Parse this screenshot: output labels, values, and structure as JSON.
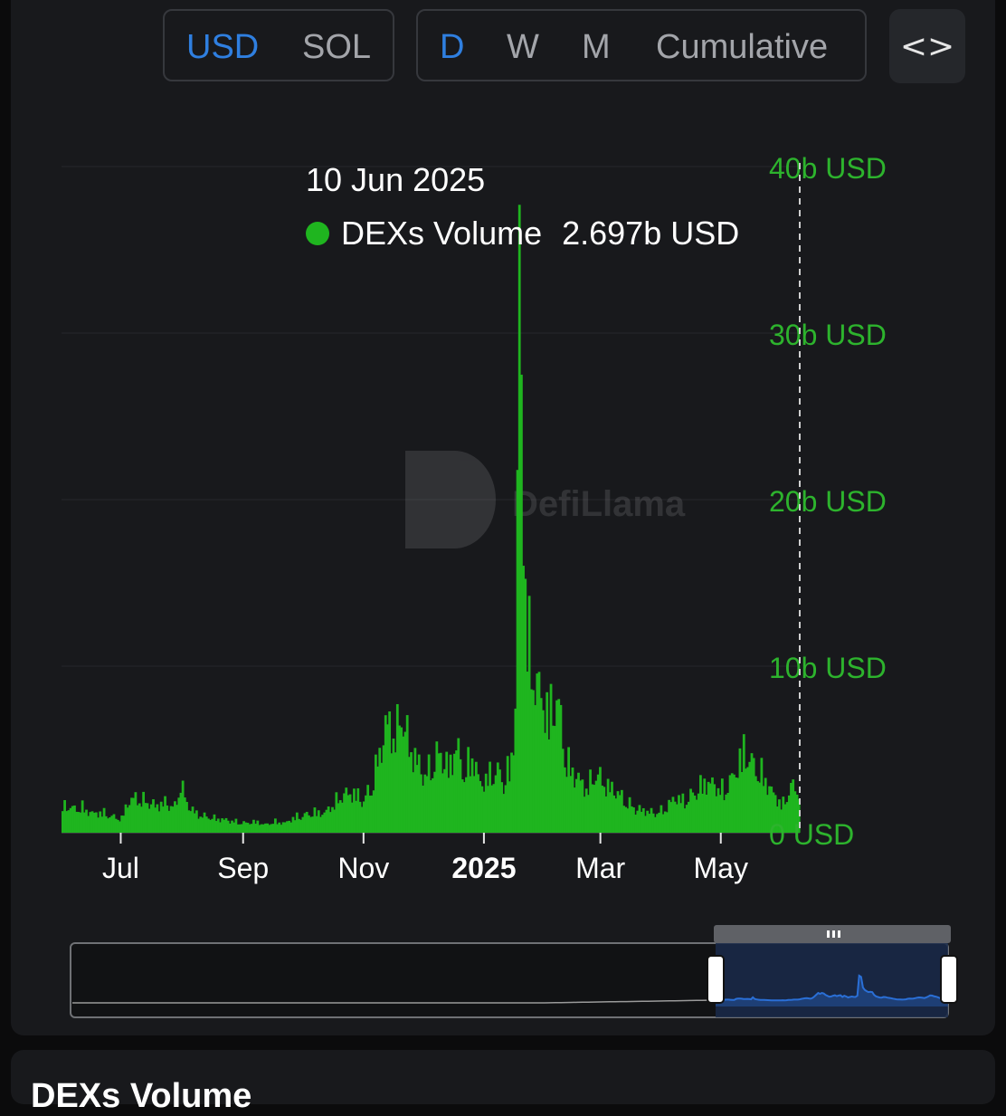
{
  "currency_toggle": {
    "options": [
      "USD",
      "SOL"
    ],
    "selected": "USD"
  },
  "period_toggle": {
    "options": [
      "D",
      "W",
      "M",
      "Cumulative"
    ],
    "selected": "D"
  },
  "embed_button": {
    "icon": "code-brackets-icon",
    "label": "<>"
  },
  "watermark": {
    "text": "DefiLlama",
    "icon": "llama-logo-icon"
  },
  "tooltip": {
    "date": "10 Jun 2025",
    "series": "DEXs Volume",
    "value": "2.697b USD",
    "color": "#1fb51f"
  },
  "bottom_card": {
    "title": "DEXs Volume"
  },
  "colors": {
    "series": "#1fb51f",
    "axis_text": "#2db32d",
    "brush": "#2a6fd6"
  },
  "chart_data": {
    "type": "bar",
    "x_start": "2024-06-01",
    "x_end": "2025-06-10",
    "y_unit": "USD",
    "ylim": [
      0,
      40000000000
    ],
    "y_ticks": [
      "0 USD",
      "10b USD",
      "20b USD",
      "30b USD",
      "40b USD"
    ],
    "x_ticks": [
      {
        "label": "Jul",
        "date": "2024-07-01",
        "bold": false
      },
      {
        "label": "Sep",
        "date": "2024-09-01",
        "bold": false
      },
      {
        "label": "Nov",
        "date": "2024-11-01",
        "bold": false
      },
      {
        "label": "2025",
        "date": "2025-01-01",
        "bold": true
      },
      {
        "label": "Mar",
        "date": "2025-03-01",
        "bold": false
      },
      {
        "label": "May",
        "date": "2025-05-01",
        "bold": false
      }
    ],
    "grid": true,
    "series": [
      {
        "name": "DEXs Volume",
        "color": "#1fb51f",
        "points": [
          [
            "2024-06-01",
            1.8
          ],
          [
            "2024-06-06",
            1.5
          ],
          [
            "2024-06-11",
            1.6
          ],
          [
            "2024-06-16",
            1.2
          ],
          [
            "2024-06-21",
            1.3
          ],
          [
            "2024-06-26",
            1.0
          ],
          [
            "2024-07-01",
            0.9
          ],
          [
            "2024-07-04",
            1.9
          ],
          [
            "2024-07-08",
            2.2
          ],
          [
            "2024-07-13",
            2.0
          ],
          [
            "2024-07-18",
            1.7
          ],
          [
            "2024-07-23",
            1.9
          ],
          [
            "2024-07-28",
            1.6
          ],
          [
            "2024-07-31",
            3.2
          ],
          [
            "2024-08-03",
            1.8
          ],
          [
            "2024-08-08",
            1.2
          ],
          [
            "2024-08-13",
            1.0
          ],
          [
            "2024-08-18",
            0.9
          ],
          [
            "2024-08-23",
            0.8
          ],
          [
            "2024-08-28",
            0.7
          ],
          [
            "2024-09-02",
            0.6
          ],
          [
            "2024-09-07",
            0.7
          ],
          [
            "2024-09-12",
            0.5
          ],
          [
            "2024-09-17",
            0.7
          ],
          [
            "2024-09-22",
            0.6
          ],
          [
            "2024-09-27",
            1.0
          ],
          [
            "2024-10-02",
            1.1
          ],
          [
            "2024-10-07",
            1.3
          ],
          [
            "2024-10-12",
            1.2
          ],
          [
            "2024-10-17",
            1.9
          ],
          [
            "2024-10-22",
            2.4
          ],
          [
            "2024-10-27",
            2.5
          ],
          [
            "2024-11-01",
            2.0
          ],
          [
            "2024-11-05",
            3.0
          ],
          [
            "2024-11-10",
            5.5
          ],
          [
            "2024-11-13",
            7.0
          ],
          [
            "2024-11-17",
            6.0
          ],
          [
            "2024-11-20",
            7.5
          ],
          [
            "2024-11-24",
            5.5
          ],
          [
            "2024-11-28",
            4.5
          ],
          [
            "2024-12-02",
            3.5
          ],
          [
            "2024-12-06",
            4.5
          ],
          [
            "2024-12-10",
            5.0
          ],
          [
            "2024-12-14",
            4.0
          ],
          [
            "2024-12-18",
            5.5
          ],
          [
            "2024-12-22",
            3.5
          ],
          [
            "2024-12-26",
            5.0
          ],
          [
            "2024-12-30",
            3.0
          ],
          [
            "2025-01-03",
            3.5
          ],
          [
            "2025-01-07",
            4.0
          ],
          [
            "2025-01-11",
            3.2
          ],
          [
            "2025-01-15",
            4.6
          ],
          [
            "2025-01-17",
            8.0
          ],
          [
            "2025-01-18",
            22.0
          ],
          [
            "2025-01-19",
            35.5
          ],
          [
            "2025-01-20",
            27.0
          ],
          [
            "2025-01-21",
            21.0
          ],
          [
            "2025-01-23",
            12.5
          ],
          [
            "2025-01-26",
            10.0
          ],
          [
            "2025-01-30",
            8.5
          ],
          [
            "2025-02-03",
            7.5
          ],
          [
            "2025-02-07",
            8.5
          ],
          [
            "2025-02-12",
            4.5
          ],
          [
            "2025-02-17",
            3.5
          ],
          [
            "2025-02-22",
            2.8
          ],
          [
            "2025-02-27",
            3.7
          ],
          [
            "2025-03-04",
            3.0
          ],
          [
            "2025-03-09",
            2.6
          ],
          [
            "2025-03-14",
            2.0
          ],
          [
            "2025-03-19",
            1.5
          ],
          [
            "2025-03-24",
            1.4
          ],
          [
            "2025-03-29",
            1.2
          ],
          [
            "2025-04-03",
            1.5
          ],
          [
            "2025-04-08",
            2.2
          ],
          [
            "2025-04-13",
            2.0
          ],
          [
            "2025-04-18",
            2.5
          ],
          [
            "2025-04-23",
            3.2
          ],
          [
            "2025-04-28",
            3.0
          ],
          [
            "2025-05-03",
            2.6
          ],
          [
            "2025-05-08",
            3.6
          ],
          [
            "2025-05-13",
            5.2
          ],
          [
            "2025-05-18",
            4.2
          ],
          [
            "2025-05-23",
            3.6
          ],
          [
            "2025-05-28",
            2.4
          ],
          [
            "2025-06-02",
            1.8
          ],
          [
            "2025-06-06",
            2.9
          ],
          [
            "2025-06-10",
            2.697
          ]
        ]
      }
    ]
  }
}
